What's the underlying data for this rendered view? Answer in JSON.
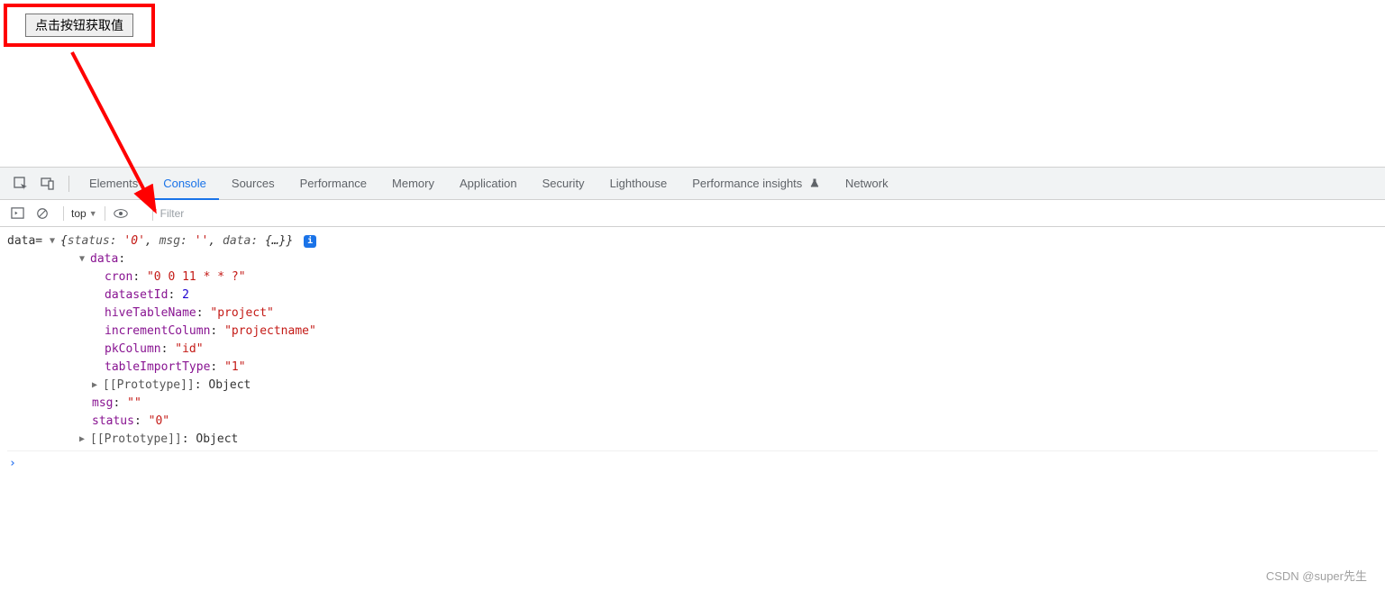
{
  "page": {
    "button_label": "点击按钮获取值"
  },
  "tabs": {
    "t0": "Elements",
    "t1": "Console",
    "t2": "Sources",
    "t3": "Performance",
    "t4": "Memory",
    "t5": "Application",
    "t6": "Security",
    "t7": "Lighthouse",
    "t8": "Performance insights",
    "t9": "Network"
  },
  "toolbar": {
    "context": "top",
    "filter_placeholder": "Filter"
  },
  "log": {
    "prefix": "data= ",
    "summary_open": "{",
    "summary_k1": "status:",
    "summary_v1": "'0'",
    "summary_sep1": ", ",
    "summary_k2": "msg:",
    "summary_v2": "''",
    "summary_sep2": ", ",
    "summary_k3": "data:",
    "summary_v3": "{…}",
    "summary_close": "}",
    "info_badge": "i",
    "data_key": "data",
    "colon": ":",
    "cron_key": "cron",
    "cron_val": "\"0 0 11 * * ?\"",
    "datasetId_key": "datasetId",
    "datasetId_val": "2",
    "hiveTableName_key": "hiveTableName",
    "hiveTableName_val": "\"project\"",
    "incrementColumn_key": "incrementColumn",
    "incrementColumn_val": "\"projectname\"",
    "pkColumn_key": "pkColumn",
    "pkColumn_val": "\"id\"",
    "tableImportType_key": "tableImportType",
    "tableImportType_val": "\"1\"",
    "proto_key": "[[Prototype]]",
    "proto_val": "Object",
    "msg_key": "msg",
    "msg_val": "\"\"",
    "status_key": "status",
    "status_val": "\"0\""
  },
  "watermark": "CSDN @super先生"
}
